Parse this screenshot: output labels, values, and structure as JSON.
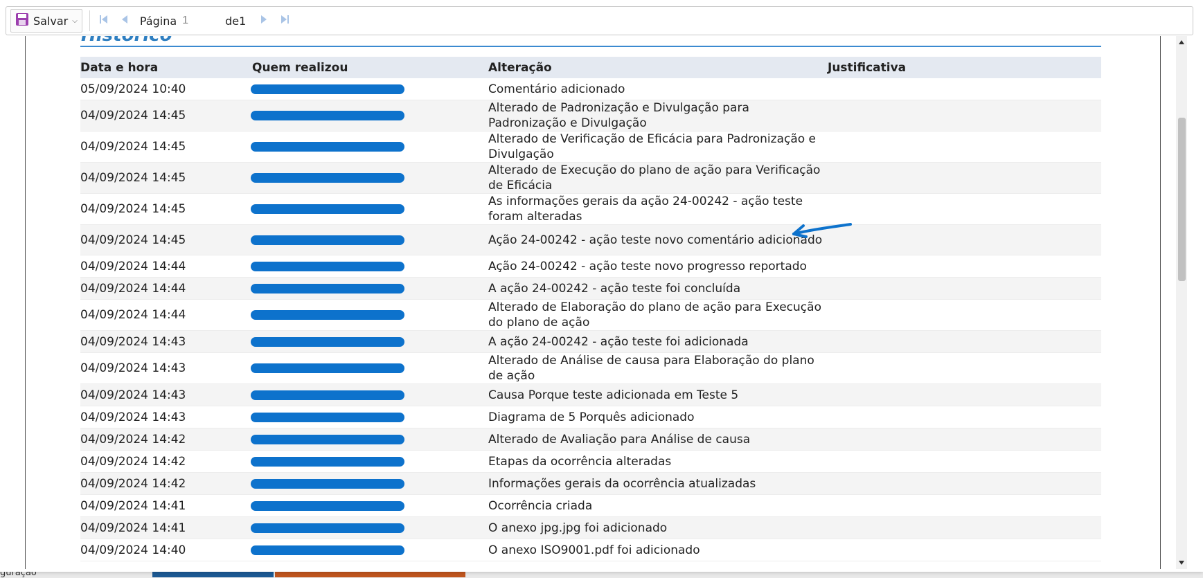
{
  "toolbar": {
    "save_label": "Salvar",
    "page_label": "Página",
    "page_value": "1",
    "page_of": "de1"
  },
  "section": {
    "title": "Histórico"
  },
  "table": {
    "headers": [
      "Data e hora",
      "Quem realizou",
      "Alteração",
      "Justificativa"
    ],
    "rows": [
      {
        "date": "05/09/2024 10:40",
        "change": "Comentário adicionado"
      },
      {
        "date": "04/09/2024 14:45",
        "change": "Alterado de Padronização e Divulgação para Padronização e Divulgação"
      },
      {
        "date": "04/09/2024 14:45",
        "change": "Alterado de Verificação de Eficácia para Padronização e Divulgação"
      },
      {
        "date": "04/09/2024 14:45",
        "change": "Alterado de Execução do plano de ação para Verificação de Eficácia"
      },
      {
        "date": "04/09/2024 14:45",
        "change": "As informações gerais da ação 24-00242 - ação teste foram alteradas"
      },
      {
        "date": "04/09/2024 14:45",
        "change": "Ação 24-00242 - ação teste novo comentário adicionado"
      },
      {
        "date": "04/09/2024 14:44",
        "change": "Ação 24-00242 - ação teste novo progresso reportado"
      },
      {
        "date": "04/09/2024 14:44",
        "change": "A ação 24-00242 - ação teste foi concluída"
      },
      {
        "date": "04/09/2024 14:44",
        "change": "Alterado de Elaboração do plano de ação para Execução do plano de ação"
      },
      {
        "date": "04/09/2024 14:43",
        "change": "A ação 24-00242 - ação teste foi adicionada"
      },
      {
        "date": "04/09/2024 14:43",
        "change": "Alterado de Análise de causa para Elaboração do plano de ação"
      },
      {
        "date": "04/09/2024 14:43",
        "change": "Causa Porque teste adicionada em Teste 5"
      },
      {
        "date": "04/09/2024 14:43",
        "change": "Diagrama de 5 Porquês adicionado"
      },
      {
        "date": "04/09/2024 14:42",
        "change": "Alterado de Avaliação para Análise de causa"
      },
      {
        "date": "04/09/2024 14:42",
        "change": "Etapas da ocorrência alteradas"
      },
      {
        "date": "04/09/2024 14:42",
        "change": "Informações gerais da ocorrência atualizadas"
      },
      {
        "date": "04/09/2024 14:41",
        "change": "Ocorrência criada"
      },
      {
        "date": "04/09/2024 14:41",
        "change": "O anexo jpg.jpg foi adicionado"
      },
      {
        "date": "04/09/2024 14:40",
        "change": "O anexo ISO9001.pdf foi adicionado"
      }
    ]
  },
  "background": {
    "bottom_text": "guração"
  },
  "colors": {
    "accent": "#2f7fc1",
    "redaction": "#0d72cc",
    "header_bg": "#e4e9f1"
  },
  "icons": [
    "save-icon",
    "chevron-down-icon",
    "first-page-icon",
    "prev-page-icon",
    "next-page-icon",
    "last-page-icon",
    "scroll-up-icon",
    "scroll-down-icon",
    "annotation-arrow-icon"
  ]
}
